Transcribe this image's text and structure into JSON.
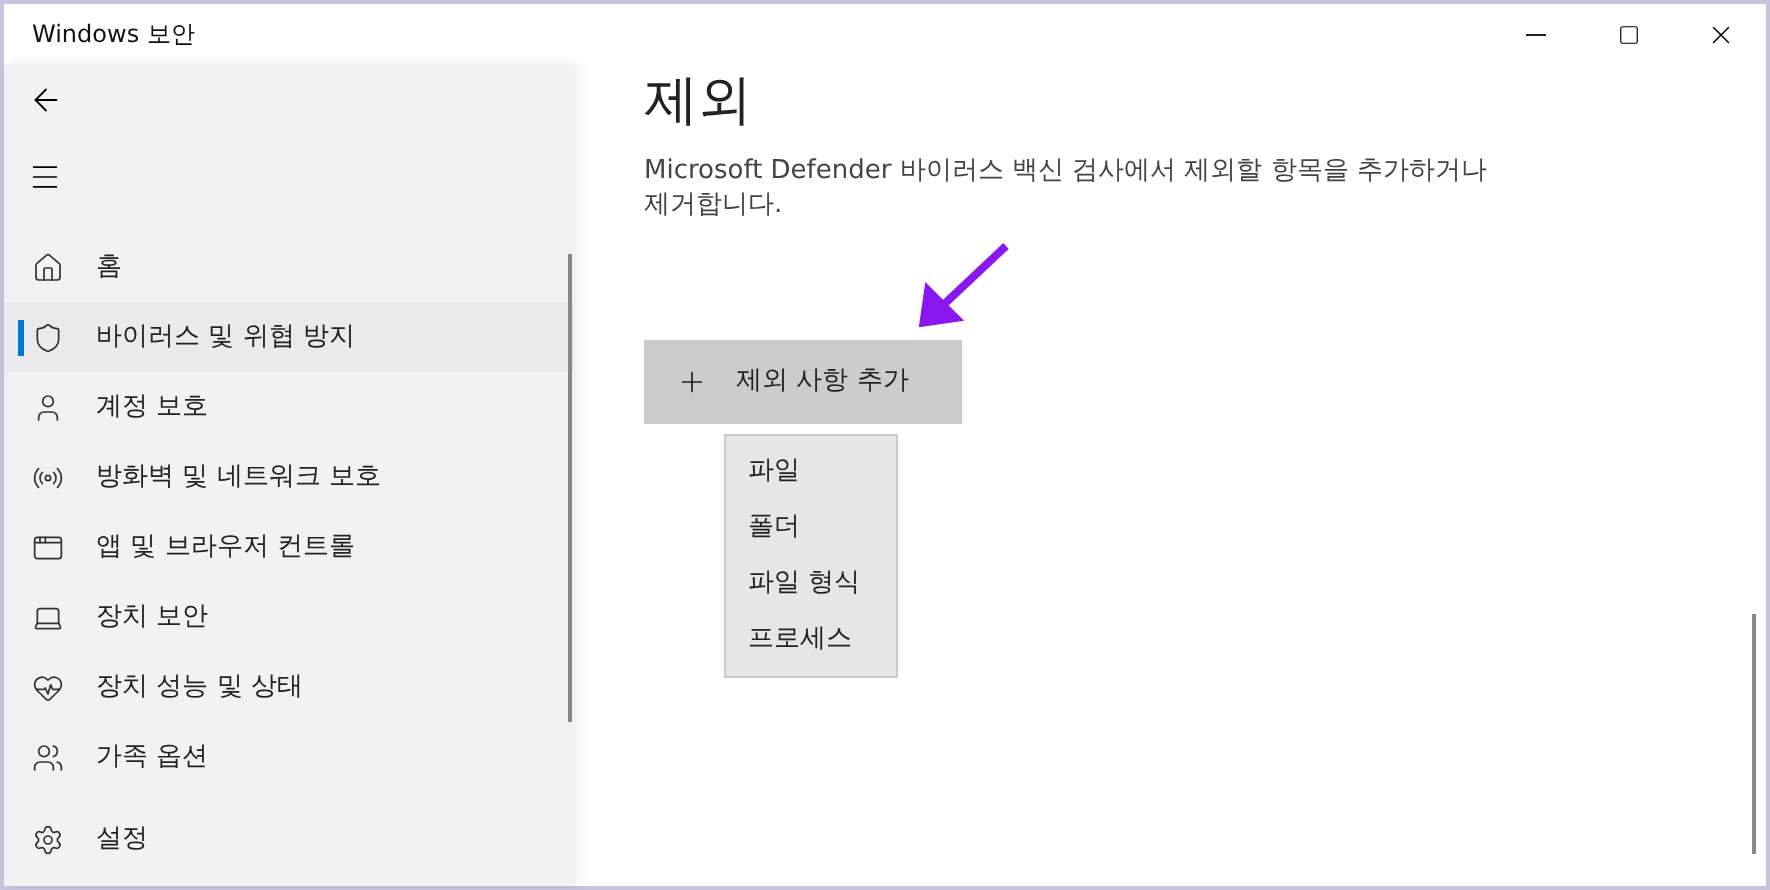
{
  "window": {
    "title": "Windows 보안"
  },
  "sidebar": {
    "items": [
      {
        "label": "홈",
        "selected": false
      },
      {
        "label": "바이러스 및 위협 방지",
        "selected": true
      },
      {
        "label": "계정 보호",
        "selected": false
      },
      {
        "label": "방화벽 및 네트워크 보호",
        "selected": false
      },
      {
        "label": "앱 및 브라우저 컨트롤",
        "selected": false
      },
      {
        "label": "장치 보안",
        "selected": false
      },
      {
        "label": "장치 성능 및 상태",
        "selected": false
      },
      {
        "label": "가족 옵션",
        "selected": false
      }
    ],
    "settings": {
      "label": "설정",
      "selected": false
    }
  },
  "page": {
    "heading": "제외",
    "description": "Microsoft Defender 바이러스 백신 검사에서 제외할 항목을 추가하거나 제거합니다.",
    "add_button": "제외 사항 추가",
    "menu": {
      "expanded": true,
      "items": [
        "파일",
        "폴더",
        "파일 형식",
        "프로세스"
      ]
    }
  }
}
